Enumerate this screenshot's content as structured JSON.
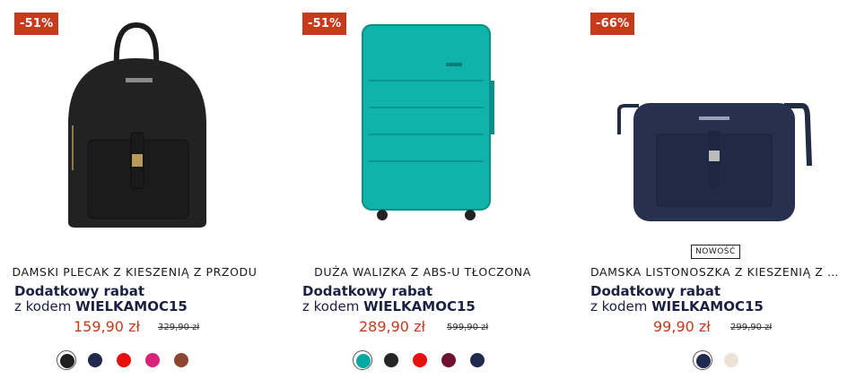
{
  "colors": {
    "accent": "#c73a1b",
    "promo_text": "#1b2140"
  },
  "products": [
    {
      "badge": "-51%",
      "title": "DAMSKI PLECAK Z KIESZENIĄ Z PRZODU",
      "promo_line1": "Dodatkowy rabat",
      "promo_line2_prefix": "z kodem",
      "promo_code": "WIELKAMOC15",
      "price": "159,90 zł",
      "old_price": "329,90 zł",
      "image_icon": "black-backpack-image",
      "swatches": [
        {
          "color": "#1e1e1e",
          "selected": true
        },
        {
          "color": "#1f2a4d",
          "selected": false
        },
        {
          "color": "#e8100f",
          "selected": false
        },
        {
          "color": "#d8237b",
          "selected": false
        },
        {
          "color": "#8a4630",
          "selected": false
        }
      ]
    },
    {
      "badge": "-51%",
      "title": "DUŻA WALIZKA Z ABS-U TŁOCZONA",
      "promo_line1": "Dodatkowy rabat",
      "promo_line2_prefix": "z kodem",
      "promo_code": "WIELKAMOC15",
      "price": "289,90 zł",
      "old_price": "599,90 zł",
      "image_icon": "turquoise-suitcase-image",
      "swatches": [
        {
          "color": "#06a9a0",
          "selected": true
        },
        {
          "color": "#262626",
          "selected": false
        },
        {
          "color": "#e8100f",
          "selected": false
        },
        {
          "color": "#6d1230",
          "selected": false
        },
        {
          "color": "#1f2a4d",
          "selected": false
        }
      ]
    },
    {
      "badge": "-66%",
      "label_new": "NOWOŚĆ",
      "title": "DAMSKA LISTONOSZKA Z KIESZENIĄ Z PRZODU",
      "promo_line1": "Dodatkowy rabat",
      "promo_line2_prefix": "z kodem",
      "promo_code": "WIELKAMOC15",
      "price": "99,90 zł",
      "old_price": "299,90 zł",
      "image_icon": "navy-crossbody-bag-image",
      "swatches": [
        {
          "color": "#1f2a4d",
          "selected": true
        },
        {
          "color": "#ece2d5",
          "selected": false
        }
      ]
    }
  ]
}
